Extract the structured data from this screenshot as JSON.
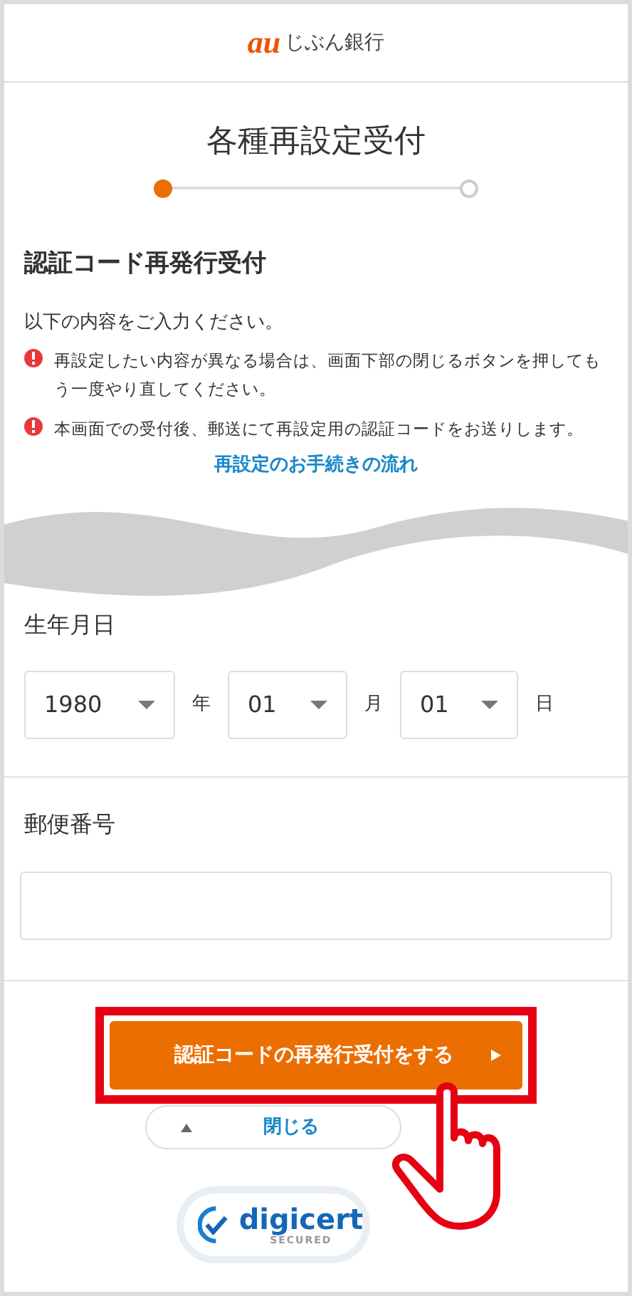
{
  "header": {
    "logo_mark": "au",
    "logo_text": "じぶん銀行"
  },
  "title": "各種再設定受付",
  "steps": [
    {
      "active": true
    },
    {
      "active": false
    }
  ],
  "section_title": "認証コード再発行受付",
  "intro": "以下の内容をご入力ください。",
  "notes": [
    "再設定したい内容が異なる場合は、画面下部の閉じるボタンを押してもう一度やり直してください。",
    "本画面での受付後、郵送にて再設定用の認証コードをお送りします。"
  ],
  "flow_link": "再設定のお手続きの流れ",
  "birthdate": {
    "label": "生年月日",
    "fields": [
      {
        "value": "1980",
        "unit": "年"
      },
      {
        "value": "01",
        "unit": "月"
      },
      {
        "value": "01",
        "unit": "日"
      }
    ]
  },
  "postal_code": {
    "label": "郵便番号"
  },
  "submit_button": {
    "label": "認証コードの再発行受付をする",
    "highlighted": true
  },
  "close_button": {
    "label": "閉じる"
  },
  "seal": {
    "brand": "digicert",
    "caption": "SECURED"
  }
}
